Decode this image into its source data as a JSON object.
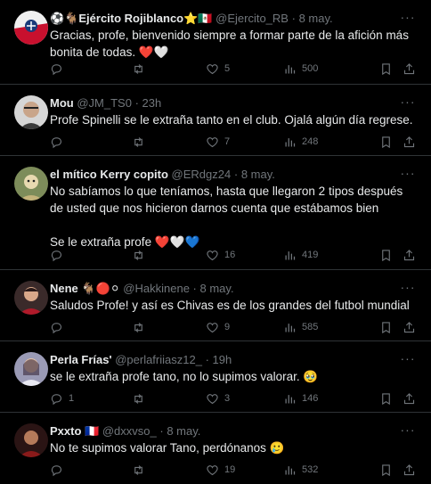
{
  "tweets": [
    {
      "name": "⚽🐐Ejército Rojiblanco⭐🇲🇽",
      "handle": "@Ejercito_RB",
      "sep": "·",
      "time": "8 may.",
      "text": [
        "Gracias, profe, bienvenido siempre a formar parte de la afición más bonita de todas. ❤️🤍"
      ],
      "replies": "",
      "retweets": "",
      "likes": "5",
      "views": "500",
      "avatar_color": "#7a1f2a"
    },
    {
      "name": "Mou",
      "handle": "@JM_TS0",
      "sep": "·",
      "time": "23h",
      "text": [
        "Profe Spinelli se le extraña tanto en el club. Ojalá algún día regrese."
      ],
      "replies": "",
      "retweets": "",
      "likes": "7",
      "views": "248",
      "avatar_color": "#b9b9b9"
    },
    {
      "name": "el mítico Kerry copito",
      "handle": "@ERdgz24",
      "sep": "·",
      "time": "8 may.",
      "text": [
        "No sabíamos lo que teníamos, hasta que llegaron 2 tipos después de usted que nos hicieron darnos cuenta que estábamos bien",
        "Se le extraña profe ❤️🤍💙"
      ],
      "replies": "",
      "retweets": "",
      "likes": "16",
      "views": "419",
      "avatar_color": "#6b7a52"
    },
    {
      "name": "Nene 🐐🔴⚪",
      "handle": "@Hakkinene",
      "sep": "·",
      "time": "8 may.",
      "text": [
        "Saludos Profe! y así es Chivas es de los grandes del futbol mundial"
      ],
      "replies": "",
      "retweets": "",
      "likes": "9",
      "views": "585",
      "avatar_color": "#a0303a"
    },
    {
      "name": "Perla Frías'",
      "handle": "@perlafriiasz12_",
      "sep": "·",
      "time": "19h",
      "text": [
        "se le extraña profe tano, no lo supimos valorar. 🥹"
      ],
      "replies": "1",
      "retweets": "",
      "likes": "3",
      "views": "146",
      "avatar_color": "#8a8aa0"
    },
    {
      "name": "Pxxto 🇫🇷",
      "handle": "@dxxvso_",
      "sep": "·",
      "time": "8 may.",
      "text": [
        "No te supimos valorar Tano, perdónanos 🥲"
      ],
      "replies": "",
      "retweets": "",
      "likes": "19",
      "views": "532",
      "avatar_color": "#5a2020"
    }
  ]
}
